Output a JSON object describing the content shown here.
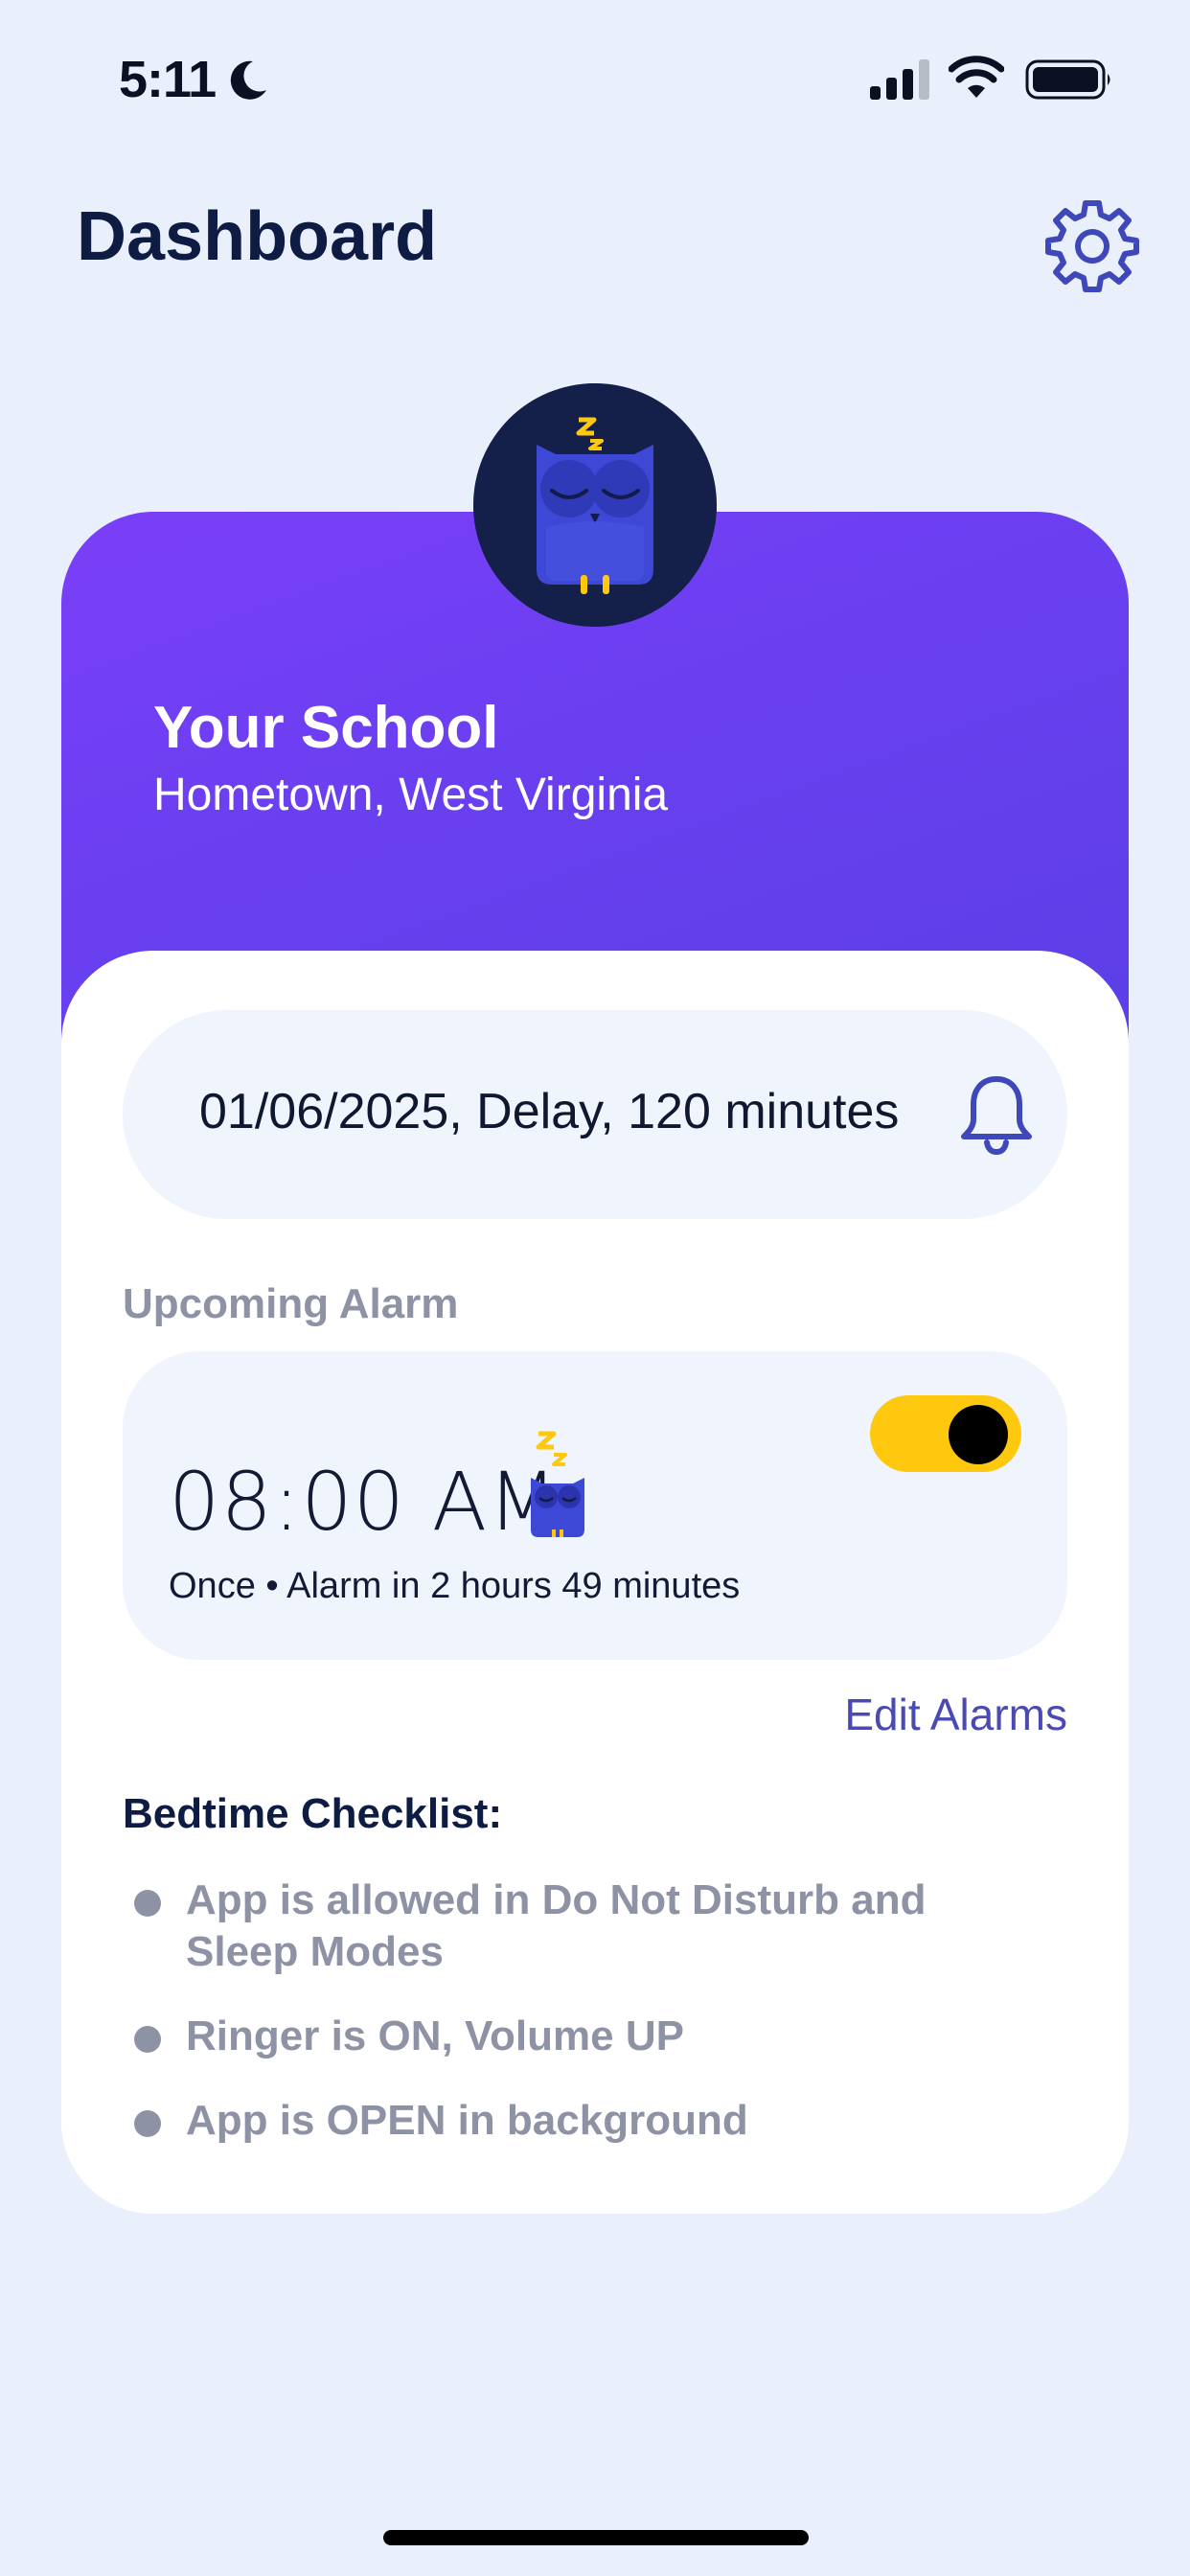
{
  "status_bar": {
    "time": "5:11"
  },
  "header": {
    "title": "Dashboard"
  },
  "school": {
    "name": "Your School",
    "location": "Hometown, West Virginia"
  },
  "announcement": {
    "text": "01/06/2025, Delay, 120 minutes"
  },
  "alarm": {
    "section_label": "Upcoming Alarm",
    "time": "08:00 AM",
    "subtitle": "Once • Alarm in 2 hours 49 minutes",
    "enabled": true
  },
  "edit_alarms_label": "Edit Alarms",
  "checklist": {
    "title": "Bedtime Checklist:",
    "items": [
      {
        "line1": "App is allowed in Do Not Disturb and",
        "line2": "Sleep Modes"
      },
      {
        "line1": "Ringer is ON, Volume UP"
      },
      {
        "line1": "App is OPEN in background"
      }
    ]
  },
  "icons": {
    "status": [
      "moon-icon",
      "signal-icon",
      "wifi-icon",
      "battery-icon"
    ],
    "settings": "gear-icon",
    "announcement": "bell-icon",
    "avatar": "sleeping-owl-icon",
    "alarm": "sleeping-owl-icon"
  },
  "colors": {
    "background": "#e9f0fb",
    "hero_gradient_start": "#7a3ff8",
    "hero_gradient_end": "#5b3fe6",
    "toggle_on": "#fdc80e",
    "link": "#4a4ab2",
    "muted_text": "#8d93a5",
    "title_text": "#0e1c44"
  }
}
